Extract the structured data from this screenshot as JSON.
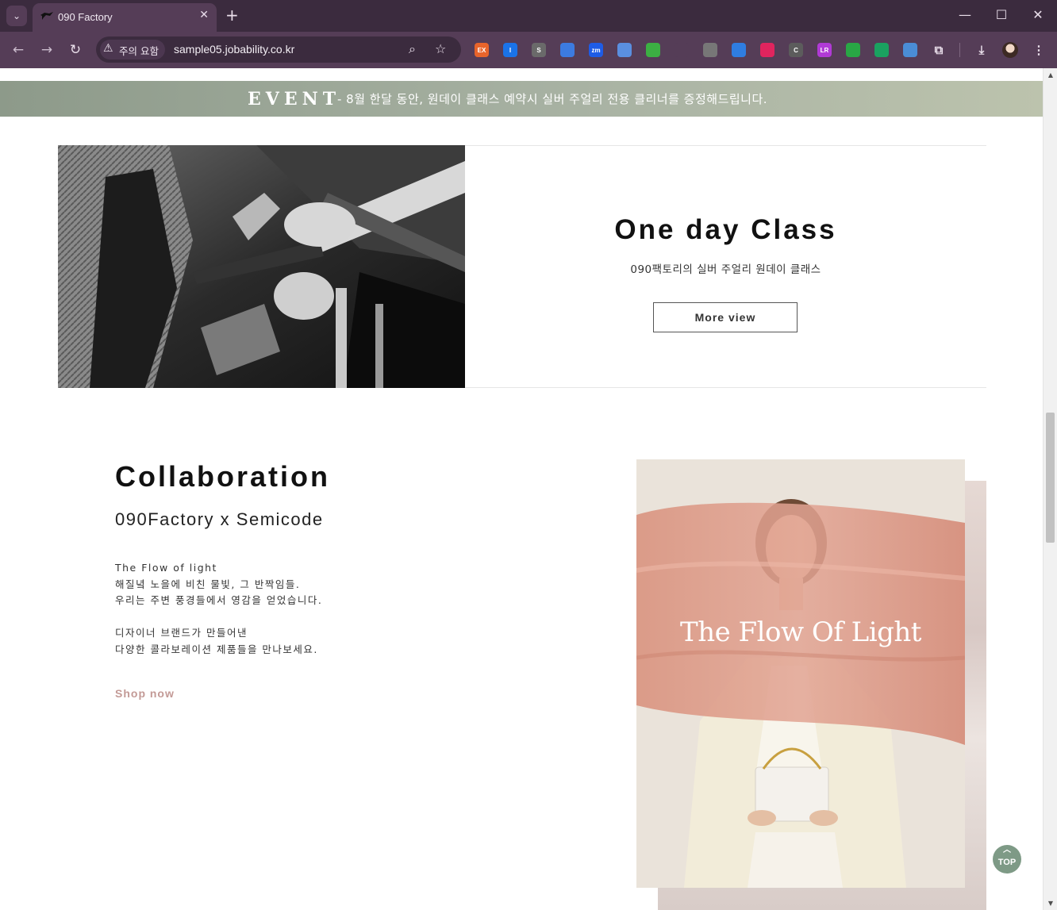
{
  "browser": {
    "tab_title": "090 Factory",
    "security_chip": "주의 요함",
    "url": "sample05.jobability.co.kr",
    "extensions": [
      {
        "name": "ex-extension-icon",
        "label": "EX",
        "color": "#e8642b"
      },
      {
        "name": "info-extension-icon",
        "label": "I",
        "color": "#1a73e8"
      },
      {
        "name": "s-extension-icon",
        "label": "S",
        "color": "#6a6a6a"
      },
      {
        "name": "drop-extension-icon",
        "label": "",
        "color": "#3c7be0"
      },
      {
        "name": "zm-extension-icon",
        "label": "zm",
        "color": "#1e5ce6"
      },
      {
        "name": "link-extension-icon",
        "label": "",
        "color": "#5a8fe0"
      },
      {
        "name": "play-extension-icon",
        "label": "",
        "color": "#3cb043"
      },
      {
        "name": "react-extension-icon",
        "label": "",
        "color": "#553d57"
      },
      {
        "name": "gear-extension-icon",
        "label": "",
        "color": "#777777"
      },
      {
        "name": "pen-extension-icon",
        "label": "",
        "color": "#2f7de1"
      },
      {
        "name": "video-extension-icon",
        "label": "",
        "color": "#e0245e"
      },
      {
        "name": "c-extension-icon",
        "label": "C",
        "color": "#5c5c5c"
      },
      {
        "name": "lr-extension-icon",
        "label": "LR",
        "color": "#b13ad6"
      },
      {
        "name": "card-extension-icon",
        "label": "",
        "color": "#29a745"
      },
      {
        "name": "chat-extension-icon",
        "label": "",
        "color": "#1aa260"
      },
      {
        "name": "globe-extension-icon",
        "label": "",
        "color": "#4a8dd6"
      }
    ]
  },
  "event": {
    "title": "EVENT",
    "text": "- 8월 한달 동안, 원데이 클래스 예약시 실버 주얼리 전용 클리너를 증정해드립니다."
  },
  "oneday": {
    "title": "One day Class",
    "subtitle": "090팩토리의 실버 주얼리 원데이 클래스",
    "button": "More view"
  },
  "collab": {
    "title": "Collaboration",
    "subtitle": "090Factory x Semicode",
    "lines": [
      "The Flow of light",
      "해질녘 노을에 비친 물빛, 그 반짝임들.",
      "우리는 주변 풍경들에서 영감을 얻었습니다.",
      "디자이너 브랜드가 만들어낸",
      "다양한 콜라보레이션 제품들을 만나보세요."
    ],
    "link": "Shop now",
    "photo_caption": "The Flow Of Light"
  },
  "top_button": "TOP"
}
